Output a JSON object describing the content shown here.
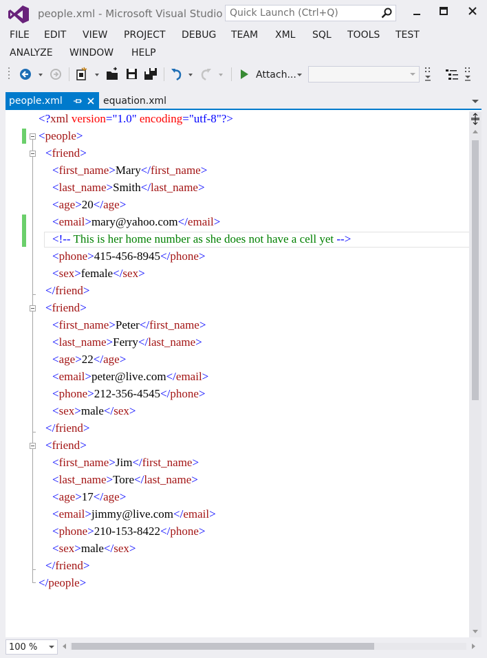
{
  "window": {
    "title": "people.xml - Microsoft Visual Studio",
    "quick_launch_placeholder": "Quick Launch (Ctrl+Q)"
  },
  "menu": {
    "items": [
      "FILE",
      "EDIT",
      "VIEW",
      "PROJECT",
      "DEBUG",
      "TEAM",
      "XML",
      "SQL",
      "TOOLS",
      "TEST",
      "ANALYZE",
      "WINDOW",
      "HELP"
    ]
  },
  "toolbar": {
    "attach_label": "Attach...",
    "icons": [
      "back-icon",
      "forward-icon",
      "new-project-icon",
      "open-file-icon",
      "save-icon",
      "save-all-icon",
      "undo-icon",
      "redo-icon",
      "start-icon"
    ]
  },
  "tabs": [
    {
      "label": "people.xml",
      "active": true
    },
    {
      "label": "equation.xml",
      "active": false
    }
  ],
  "editor": {
    "lines": [
      "<?xml version=\"1.0\" encoding=\"utf-8\"?>",
      "<people>",
      "<friend>",
      "<first_name>Mary</first_name>",
      "<last_name>Smith</last_name>",
      "<age>20</age>",
      "<email>mary@yahoo.com</email>",
      "<!-- This is her home number as she does not have a cell yet -->",
      "<phone>415-456-8945</phone>",
      "<sex>female</sex>",
      "</friend>",
      "<friend>",
      "<first_name>Peter</first_name>",
      "<last_name>Ferry</last_name>",
      "<age>22</age>",
      "<email>peter@live.com</email>",
      "<phone>212-356-4545</phone>",
      "<sex>male</sex>",
      "</friend>",
      "<friend>",
      "<first_name>Jim</first_name>",
      "<last_name>Tore</last_name>",
      "<age>17</age>",
      "<email>jimmy@live.com</email>",
      "<phone>210-153-8422</phone>",
      "<sex>male</sex>",
      "</friend>",
      "</people>"
    ]
  },
  "status": {
    "zoom": "100 %"
  },
  "colors": {
    "accent": "#007acc",
    "xml_bracket": "#0000ff",
    "xml_tag": "#a31515",
    "xml_attr": "#ff0000",
    "xml_comment": "#008000",
    "change_marker": "#6bcf6b"
  }
}
